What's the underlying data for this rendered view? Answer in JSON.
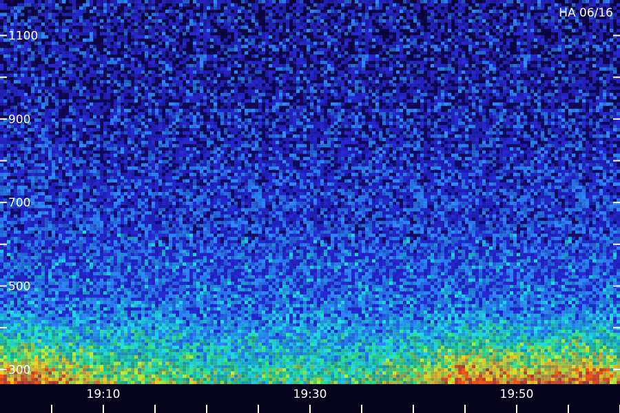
{
  "chart_data": {
    "type": "heatmap",
    "title": "HA 06/16",
    "xlabel": "",
    "ylabel": "",
    "y_ticks": [
      {
        "value": 300,
        "label": "300"
      },
      {
        "value": 400,
        "label": ""
      },
      {
        "value": 500,
        "label": "500"
      },
      {
        "value": 600,
        "label": ""
      },
      {
        "value": 700,
        "label": "700"
      },
      {
        "value": 800,
        "label": ""
      },
      {
        "value": 900,
        "label": "900"
      },
      {
        "value": 1000,
        "label": ""
      },
      {
        "value": 1100,
        "label": "1100"
      }
    ],
    "ylim": [
      265,
      1185
    ],
    "x_ticks": [
      {
        "value": "19:05",
        "label": ""
      },
      {
        "value": "19:10",
        "label": "19:10"
      },
      {
        "value": "19:15",
        "label": ""
      },
      {
        "value": "19:20",
        "label": ""
      },
      {
        "value": "19:25",
        "label": ""
      },
      {
        "value": "19:30",
        "label": "19:30"
      },
      {
        "value": "19:35",
        "label": ""
      },
      {
        "value": "19:40",
        "label": ""
      },
      {
        "value": "19:45",
        "label": ""
      },
      {
        "value": "19:50",
        "label": "19:50"
      },
      {
        "value": "19:55",
        "label": ""
      },
      {
        "value": "20:00",
        "label": ""
      }
    ],
    "xlim": [
      "19:00",
      "20:00"
    ],
    "grid": false,
    "colormap": [
      "#1a0a5a",
      "#2a2ad8",
      "#2f8cff",
      "#22e0e6",
      "#33f08a",
      "#b8f53a",
      "#ffd21a",
      "#ff5a10"
    ],
    "intensity_by_time": [
      {
        "time": "19:00",
        "level": 0.85
      },
      {
        "time": "19:03",
        "level": 0.95
      },
      {
        "time": "19:06",
        "level": 0.75
      },
      {
        "time": "19:09",
        "level": 0.6
      },
      {
        "time": "19:12",
        "level": 0.45
      },
      {
        "time": "19:15",
        "level": 0.5
      },
      {
        "time": "19:18",
        "level": 0.4
      },
      {
        "time": "19:21",
        "level": 0.3
      },
      {
        "time": "19:24",
        "level": 0.25
      },
      {
        "time": "19:27",
        "level": 0.3
      },
      {
        "time": "19:30",
        "level": 0.35
      },
      {
        "time": "19:33",
        "level": 0.3
      },
      {
        "time": "19:36",
        "level": 0.35
      },
      {
        "time": "19:39",
        "level": 0.5
      },
      {
        "time": "19:42",
        "level": 0.6
      },
      {
        "time": "19:45",
        "level": 0.95
      },
      {
        "time": "19:48",
        "level": 0.85
      },
      {
        "time": "19:51",
        "level": 0.75
      },
      {
        "time": "19:54",
        "level": 0.8
      },
      {
        "time": "19:57",
        "level": 0.95
      },
      {
        "time": "20:00",
        "level": 0.7
      }
    ]
  }
}
